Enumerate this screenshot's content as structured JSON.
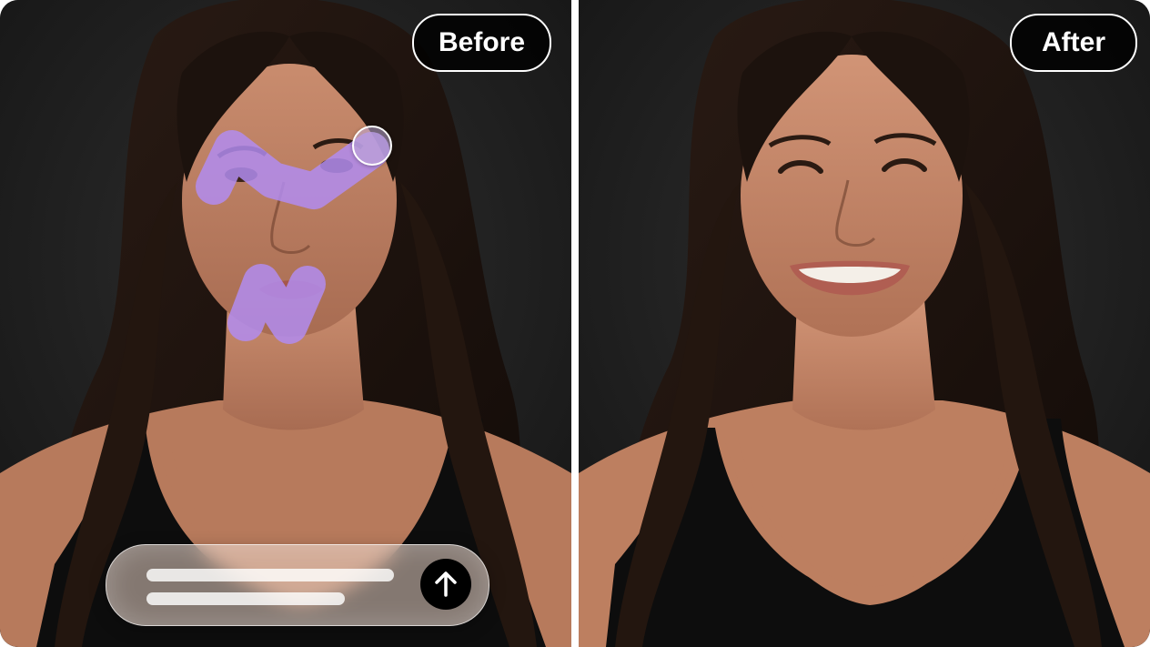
{
  "panels": {
    "before": {
      "label": "Before",
      "image": "portrait-neutral-expression"
    },
    "after": {
      "label": "After",
      "image": "portrait-smiling"
    }
  },
  "editor": {
    "mask_color": "#b28cf0",
    "brush_tool": "brush-cursor",
    "prompt_state": "placeholder-lines",
    "send_icon": "arrow-up-icon"
  },
  "colors": {
    "background": "#1f1f1f",
    "badge_bg": "#000000",
    "badge_border": "#ffffff",
    "badge_text": "#ffffff",
    "divider": "#ffffff"
  }
}
